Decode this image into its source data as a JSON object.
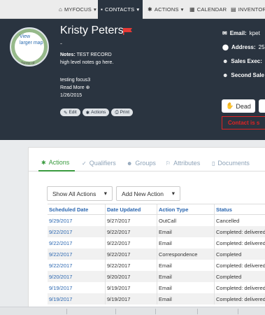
{
  "nav": {
    "items": [
      {
        "label": "MYFOCUS",
        "icon": "home-icon",
        "glyph": "⌂"
      },
      {
        "label": "CONTACTS",
        "icon": "contact-card-icon",
        "glyph": "▪"
      },
      {
        "label": "ACTIONS",
        "icon": "gears-icon",
        "glyph": "✱"
      },
      {
        "label": "CALENDAR",
        "icon": "calendar-icon",
        "glyph": "▦"
      },
      {
        "label": "INVENTORY",
        "icon": "inventory-icon",
        "glyph": "▤"
      }
    ]
  },
  "contact": {
    "map_link": "View larger map",
    "map_terms": "Terms of",
    "name": "Kristy Peters",
    "flag_color": "#e53935",
    "dash": "-",
    "notes_label": "Notes:",
    "notes_value": "TEST RECORD",
    "notes_line2": "high level notes go here.",
    "extra_note": "testing focus3",
    "read_more": "Read More",
    "date": "1/26/2015",
    "buttons": {
      "edit": "Edit",
      "actions": "Actions",
      "print": "Print"
    }
  },
  "info": {
    "email_label": "Email:",
    "email_value": "kpet",
    "address_label": "Address:",
    "address_value": "25",
    "sales_exec_label": "Sales Exec:",
    "second_sales_label": "Second Sale"
  },
  "status": {
    "dead_label": "Dead",
    "red_text": "Contact is s"
  },
  "tabs": [
    {
      "label": "Actions",
      "icon": "gears-icon",
      "glyph": "✱"
    },
    {
      "label": "Qualifiers",
      "icon": "check-circle-icon",
      "glyph": "✓"
    },
    {
      "label": "Groups",
      "icon": "users-icon",
      "glyph": "☻"
    },
    {
      "label": "Attributes",
      "icon": "flag-outline-icon",
      "glyph": "⚐"
    },
    {
      "label": "Documents",
      "icon": "document-icon",
      "glyph": "▯"
    }
  ],
  "filters": {
    "show": "Show All Actions",
    "add": "Add New Action"
  },
  "table": {
    "headers": [
      "Scheduled Date",
      "Date Updated",
      "Action Type",
      "Status"
    ],
    "rows": [
      [
        "9/29/2017",
        "9/27/2017",
        "OutCall",
        "Cancelled"
      ],
      [
        "9/22/2017",
        "9/22/2017",
        "Email",
        "Completed: delivered"
      ],
      [
        "9/22/2017",
        "9/22/2017",
        "Email",
        "Completed: delivered"
      ],
      [
        "9/22/2017",
        "9/22/2017",
        "Correspondence",
        "Completed"
      ],
      [
        "9/22/2017",
        "9/22/2017",
        "Email",
        "Completed: delivered"
      ],
      [
        "9/20/2017",
        "9/20/2017",
        "Email",
        "Completed"
      ],
      [
        "9/19/2017",
        "9/19/2017",
        "Email",
        "Completed: delivered"
      ],
      [
        "9/19/2017",
        "9/19/2017",
        "Email",
        "Completed: delivered"
      ]
    ]
  }
}
